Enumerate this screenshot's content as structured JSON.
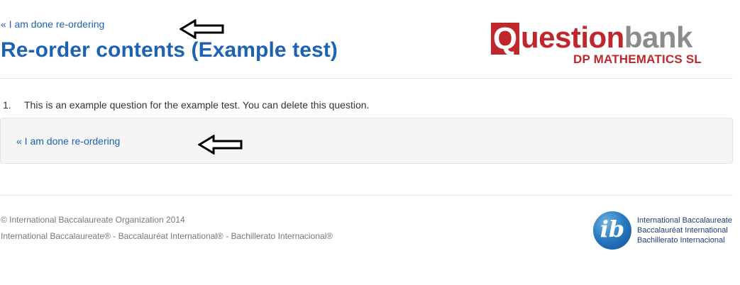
{
  "header": {
    "top_link": "« I am done re-ordering",
    "title": "Re-order contents (Example test)"
  },
  "logo": {
    "q_letter": "Q",
    "word_question": "uestion",
    "word_bank": "bank",
    "subtitle": "DP MATHEMATICS SL"
  },
  "questions": [
    {
      "number": "1.",
      "text": "This is an example question for the example test. You can delete this question."
    }
  ],
  "well": {
    "link": "« I am done re-ordering"
  },
  "footer": {
    "copyright": "© International Baccalaureate Organization 2014",
    "names": "International Baccalaureate® - Baccalauréat International® - Bachillerato Internacional®"
  },
  "ib_logo": {
    "mark": "ib",
    "line1": "International Baccalaureate",
    "line2": "Baccalauréat International",
    "line3": "Bachillerato Internacional"
  },
  "colors": {
    "link": "#1e62b3",
    "brand_red": "#c0272d",
    "brand_gray": "#8c8c8c"
  },
  "icons": [
    "arrow-left-icon",
    "arrow-left-icon",
    "ib-logo-icon"
  ]
}
